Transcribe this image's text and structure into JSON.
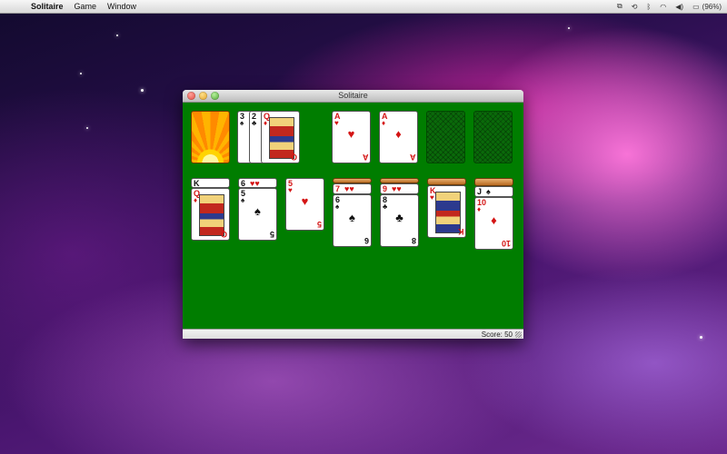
{
  "menubar": {
    "apple": "",
    "app_name": "Solitaire",
    "items": [
      "Game",
      "Window"
    ],
    "battery": "(96%)"
  },
  "window": {
    "title": "Solitaire",
    "status": "Score: 50"
  },
  "game": {
    "stock": {
      "face_down": true
    },
    "waste": [
      {
        "rank": "3",
        "suit": "♠",
        "color": "black"
      },
      {
        "rank": "2",
        "suit": "♣",
        "color": "black"
      },
      {
        "rank": "Q",
        "suit": "♦",
        "color": "red"
      }
    ],
    "foundations": [
      {
        "rank": "A",
        "suit": "♥",
        "color": "red"
      },
      {
        "rank": "A",
        "suit": "♦",
        "color": "red"
      },
      {
        "empty": true
      },
      {
        "empty": true
      }
    ],
    "tableau": [
      {
        "top_label": "K",
        "card": {
          "rank": "Q",
          "suit": "♦",
          "color": "red",
          "face": true
        }
      },
      {
        "top_label": "6♥",
        "card": {
          "rank": "5",
          "suit": "♠",
          "color": "black"
        }
      },
      {
        "top_label": "",
        "card": {
          "rank": "5",
          "suit": "♥",
          "color": "red"
        }
      },
      {
        "top_label": "7♥",
        "card": {
          "rank": "6",
          "suit": "♠",
          "color": "black"
        }
      },
      {
        "top_label": "9♥",
        "card": {
          "rank": "8",
          "suit": "♣",
          "color": "black"
        }
      },
      {
        "top_label": "",
        "card": {
          "rank": "K",
          "suit": "♥",
          "color": "red",
          "face": true
        }
      },
      {
        "top_label": "J♠",
        "card": {
          "rank": "10",
          "suit": "♦",
          "color": "red"
        }
      }
    ]
  },
  "labels": {
    "t0_top": "K",
    "t1_top_rank": "6",
    "t1_top_suit": "♥♥",
    "t3_top_rank": "7",
    "t3_top_suit": "♥♥",
    "t4_top_rank": "9",
    "t4_top_suit": "♥♥",
    "t6_top_rank": "J",
    "t6_top_suit": "♠"
  }
}
